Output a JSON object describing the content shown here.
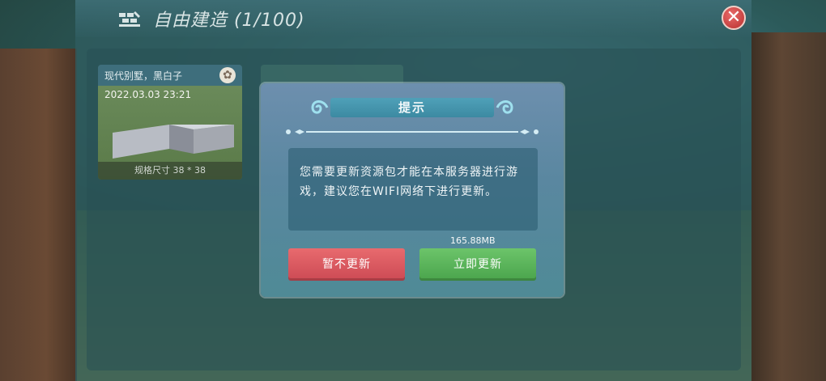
{
  "header": {
    "icon": "build-icon",
    "title": "自由建造 (1/100)",
    "close_icon": "close-icon"
  },
  "save_card": {
    "name": "现代别墅，黑白子",
    "date": "2022.03.03 23:21",
    "size": "规格尺寸 38 * 38",
    "settings_icon": "gear-icon"
  },
  "dialog": {
    "title": "提示",
    "message": "您需要更新资源包才能在本服务器进行游戏，建议您在WIFI网络下进行更新。",
    "download_size": "165.88MB",
    "later_label": "暂不更新",
    "update_label": "立即更新"
  },
  "colors": {
    "later_button": "#d85560",
    "update_button": "#5cb45a",
    "dialog_bg": "#5f8aa2",
    "close_button": "#c83a36"
  }
}
